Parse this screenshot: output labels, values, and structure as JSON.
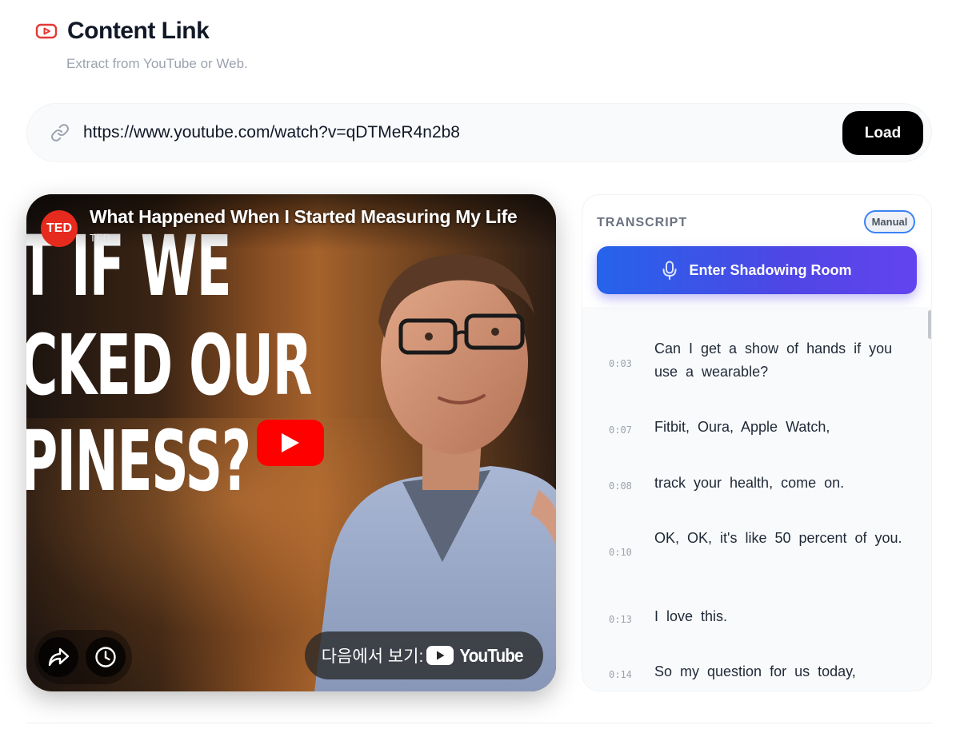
{
  "header": {
    "title": "Content Link",
    "subtitle": "Extract from YouTube or Web."
  },
  "url_bar": {
    "value": "https://www.youtube.com/watch?v=qDTMeR4n2b8",
    "load_label": "Load"
  },
  "video": {
    "channel_logo": "TED",
    "title": "What Happened When I Started Measuring My Life",
    "channel": "TED",
    "thumbnail_lines": [
      "T IF WE",
      "CKED OUR",
      "PINESS?"
    ],
    "watch_on_label": "다음에서 보기:",
    "youtube_label": "YouTube"
  },
  "transcript": {
    "label": "TRANSCRIPT",
    "badge": "Manual",
    "shadowing_label": "Enter Shadowing Room",
    "lines": [
      {
        "time": "0:03",
        "text": "Can I get a show of hands if you use a wearable?"
      },
      {
        "time": "0:07",
        "text": "Fitbit, Oura, Apple Watch,"
      },
      {
        "time": "0:08",
        "text": "track your health, come on."
      },
      {
        "time": "0:10",
        "text": "OK, OK, it's like 50 percent of you."
      },
      {
        "time": "0:13",
        "text": "I love this."
      },
      {
        "time": "0:14",
        "text": "So my question for us today,"
      }
    ]
  },
  "colors": {
    "accent_red": "#e53935",
    "shadowing_gradient_start": "#2563eb",
    "shadowing_gradient_end": "#6344ee",
    "load_button": "#000000"
  }
}
